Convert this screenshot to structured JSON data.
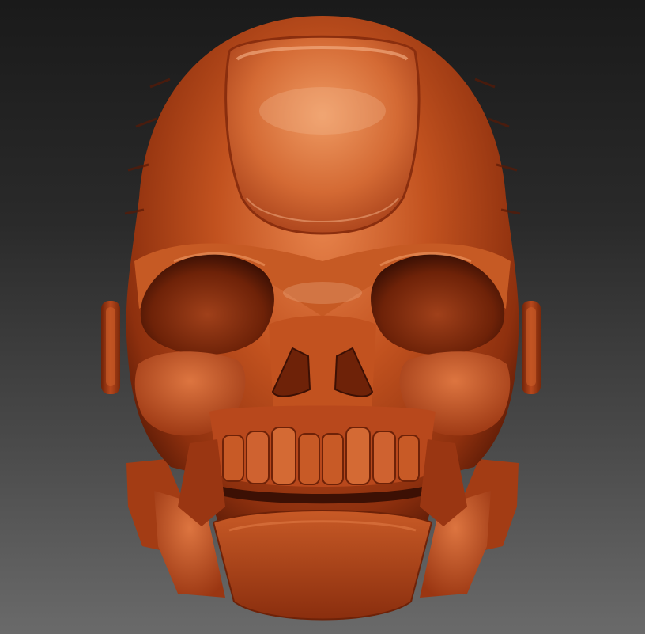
{
  "scene": {
    "subject": "skull-sculpt",
    "material_colors": {
      "base": "#b8481c",
      "light": "#e07a45",
      "highlight": "#f6b48a",
      "shadow": "#6e2208",
      "deep": "#3c1004"
    },
    "background_colors": {
      "top": "#1a1a1a",
      "bottom": "#6a6a6a"
    }
  }
}
